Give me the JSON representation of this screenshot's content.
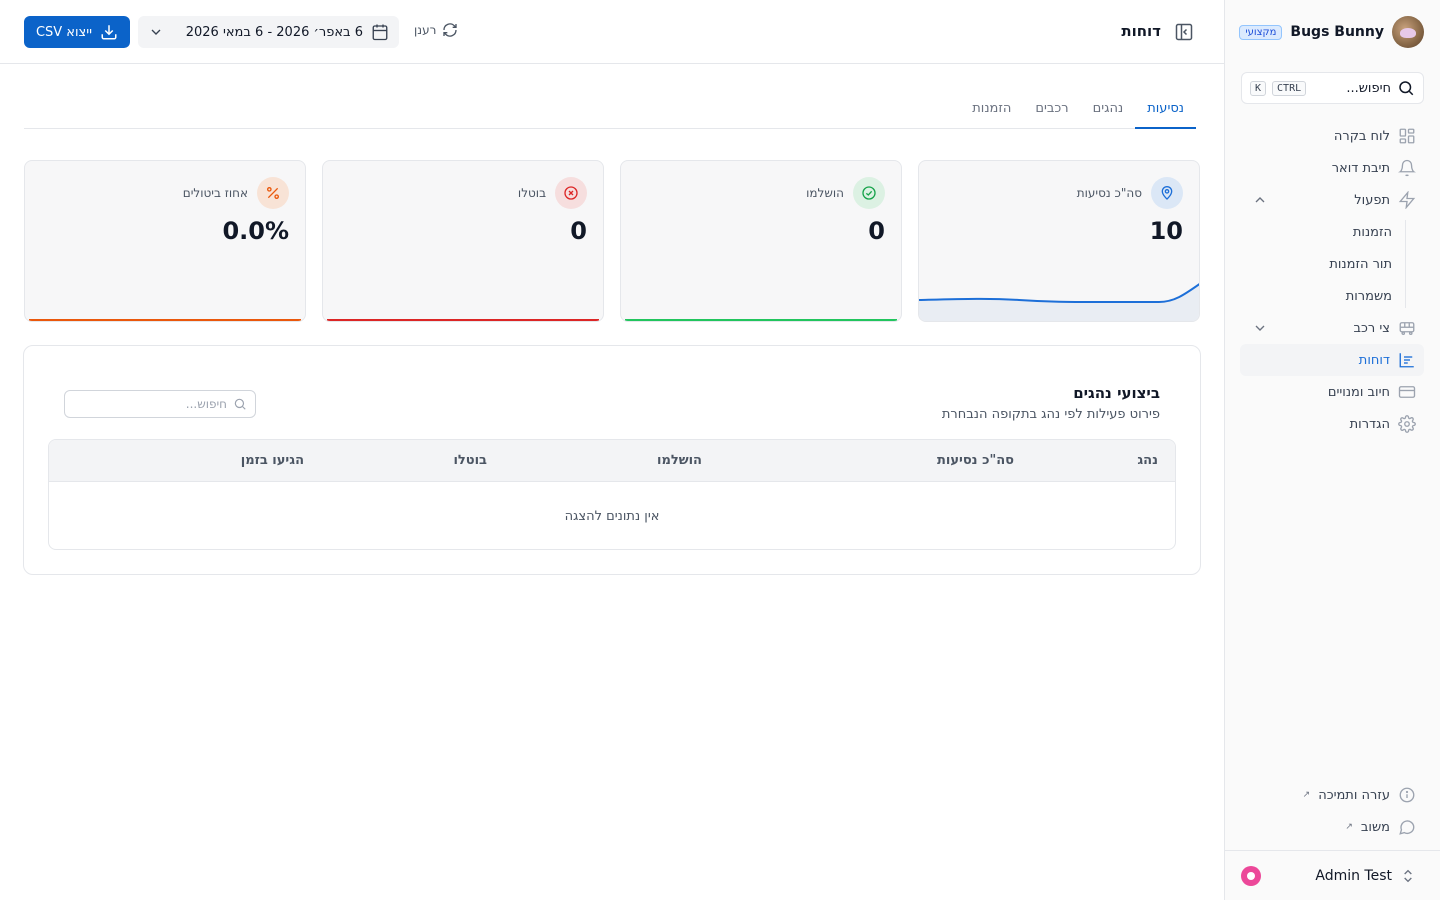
{
  "sidebar": {
    "brand_name": "Bugs Bunny",
    "brand_badge": "מקצועי",
    "search_label": "חיפוש...",
    "search_shortcut": [
      "CTRL",
      "K"
    ],
    "items": [
      {
        "label": "לוח בקרה",
        "icon": "grid-icon"
      },
      {
        "label": "תיבת דואר",
        "icon": "bell-icon"
      },
      {
        "label": "תפעול",
        "icon": "lightning-icon",
        "expanded": true
      },
      {
        "label": "הזמנות"
      },
      {
        "label": "תור הזמנות"
      },
      {
        "label": "משמרות"
      },
      {
        "label": "צי רכב",
        "icon": "bus-icon",
        "expanded": false
      },
      {
        "label": "דוחות",
        "icon": "chart-icon",
        "active": true
      },
      {
        "label": "חיוב ומנויים",
        "icon": "credit-card-icon"
      },
      {
        "label": "הגדרות",
        "icon": "gear-icon"
      }
    ],
    "bottom_links": [
      {
        "label": "עזרה ותמיכה",
        "icon": "info-icon"
      },
      {
        "label": "משוב",
        "icon": "chat-bubble-icon"
      }
    ],
    "user_name": "Admin Test"
  },
  "header": {
    "title": "דוחות",
    "export_label": "ייצוא CSV",
    "date_range": "6 באפר׳ 2026 - 6 במאי 2026",
    "refresh_label": "רענן"
  },
  "tabs": [
    {
      "label": "נסיעות",
      "active": true
    },
    {
      "label": "נהגים",
      "active": false
    },
    {
      "label": "רכבים",
      "active": false
    },
    {
      "label": "הזמנות",
      "active": false
    }
  ],
  "stats": [
    {
      "label": "סה\"כ נסיעות",
      "value": "10",
      "icon": "map-pin-icon",
      "color": "#1d6fd8",
      "tint": "#dbe7f6"
    },
    {
      "label": "הושלמו",
      "value": "0",
      "icon": "check-circle-icon",
      "color": "#16a34a",
      "tint": "#dcf1e3"
    },
    {
      "label": "בוטלו",
      "value": "0",
      "icon": "x-circle-icon",
      "color": "#dc2626",
      "tint": "#f6dede"
    },
    {
      "label": "אחוז ביטולים",
      "value": "0.0%",
      "icon": "percent-icon",
      "color": "#ea580c",
      "tint": "#f8e3d6"
    }
  ],
  "driver_table": {
    "title": "ביצועי נהגים",
    "subtitle": "פירוט פעילות לפי נהג בתקופה הנבחרת",
    "search_placeholder": "חיפוש...",
    "columns": [
      "נהג",
      "סה\"כ נסיעות",
      "הושלמו",
      "בוטלו",
      "הגיעו בזמן"
    ],
    "empty_text": "אין נתונים להצגה"
  }
}
